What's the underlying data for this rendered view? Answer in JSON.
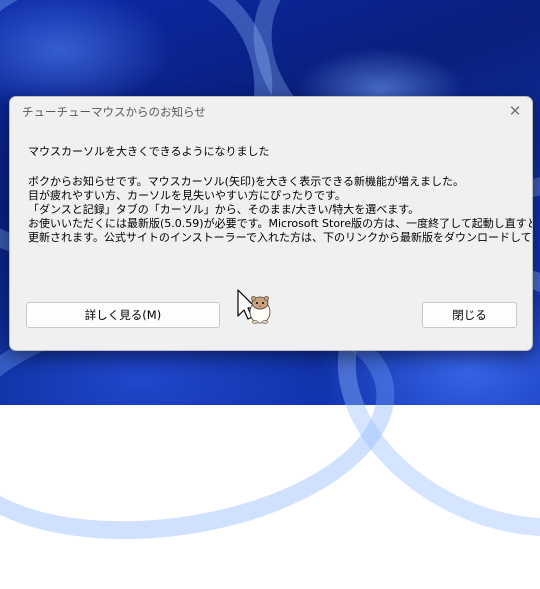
{
  "dialog": {
    "title": "チューチューマウスからのお知らせ",
    "heading": "マウスカーソルを大きくできるようになりました",
    "lines": [
      "ボクからお知らせです。マウスカーソル(矢印)を大きく表示できる新機能が増えました。",
      "目が疲れやすい方、カーソルを見失いやすい方にぴったりです。",
      "「ダンスと記録」タブの「カーソル」から、そのまま/大きい/特大を選べます。",
      "お使いいただくには最新版(5.0.59)が必要です。Microsoft Store版の方は、一度終了して起動し直すと",
      "更新されます。公式サイトのインストーラーで入れた方は、下のリンクから最新版をダウンロードしてください。"
    ],
    "details_button": "詳しく見る(M)",
    "close_button": "閉じる",
    "close_glyph": "✕"
  },
  "icons": {
    "close": "close-icon",
    "cursor": "arrow-cursor-icon",
    "mascot": "hamster-mascot-icon"
  },
  "colors": {
    "dialog_bg": "#f0f0f0",
    "wallpaper": "#0b2aa8"
  }
}
